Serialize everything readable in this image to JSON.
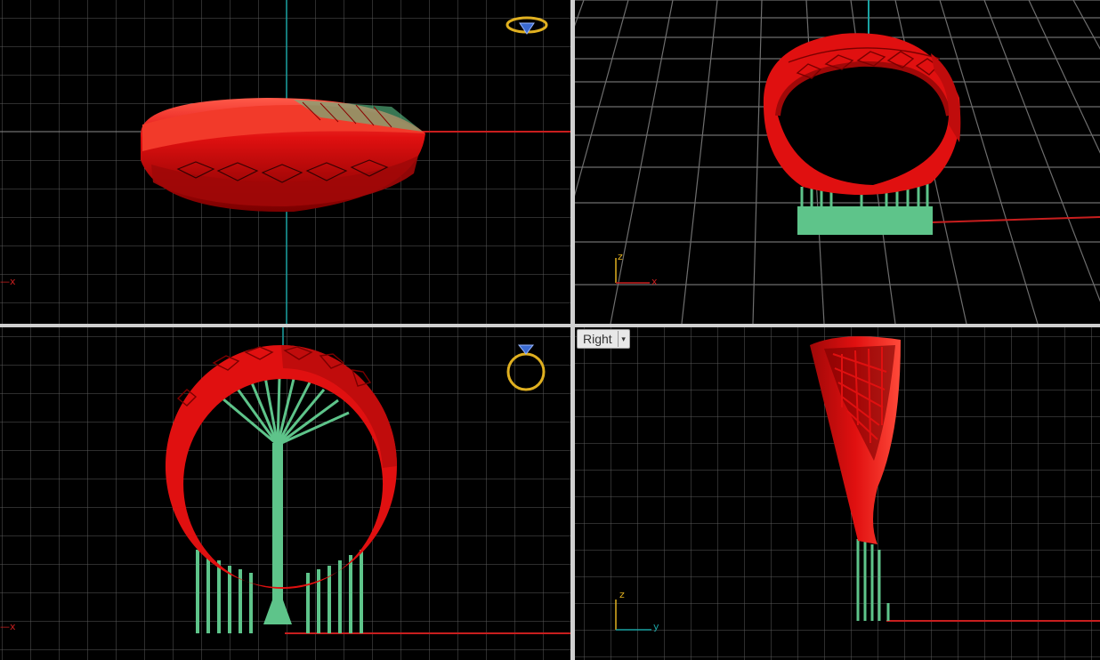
{
  "viewports": {
    "top": {
      "axis_x": "x"
    },
    "perspective": {
      "axis_x": "x",
      "axis_z": "z"
    },
    "front": {
      "axis_x": "x"
    },
    "right": {
      "label": "Right",
      "dropdown_glyph": "▾",
      "axis_y": "y",
      "axis_z": "z"
    }
  },
  "icons": {
    "top_corner": "ring-top-view-icon",
    "front_corner": "ring-front-view-icon",
    "label_dropdown": "chevron-down-icon"
  },
  "colors": {
    "background": "#000000",
    "grid": "#5a5a5a",
    "grid_major": "#8a8a8a",
    "axis_x": "#c81e1e",
    "axis_y": "#1aa3a3",
    "model": "#e01010",
    "supports": "#5ec48a",
    "icon_gold": "#e0b020"
  }
}
